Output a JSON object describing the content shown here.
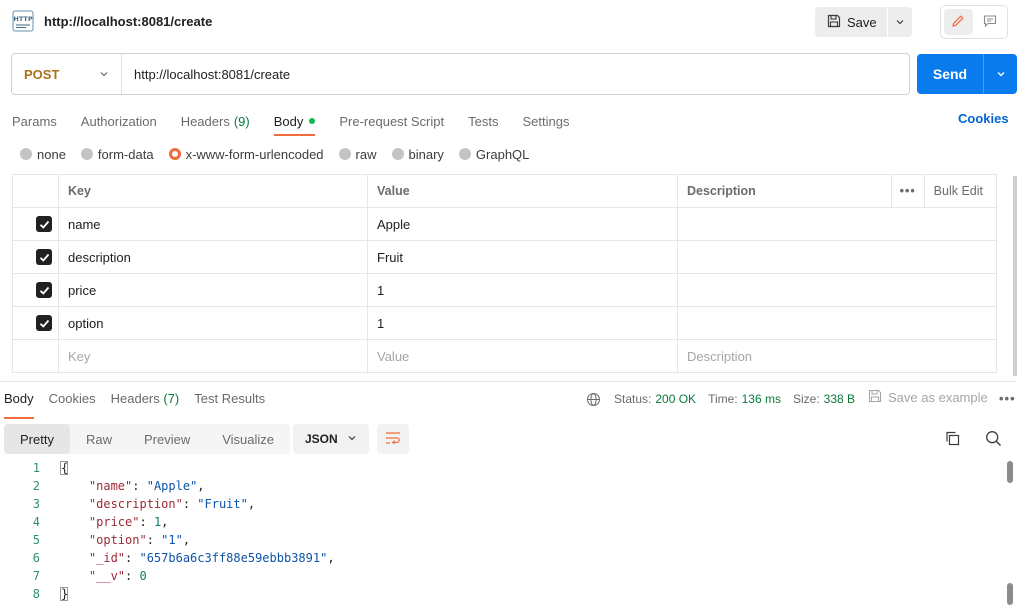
{
  "tab": {
    "title": "http://localhost:8081/create",
    "icon": "http-request-icon"
  },
  "toolbar": {
    "save_label": "Save"
  },
  "request": {
    "method": "POST",
    "url": "http://localhost:8081/create",
    "send_label": "Send"
  },
  "request_tabs": [
    {
      "label": "Params"
    },
    {
      "label": "Authorization"
    },
    {
      "label": "Headers",
      "count": "(9)"
    },
    {
      "label": "Body",
      "active": true
    },
    {
      "label": "Pre-request Script"
    },
    {
      "label": "Tests"
    },
    {
      "label": "Settings"
    }
  ],
  "cookies_link": "Cookies",
  "body_types": [
    {
      "label": "none"
    },
    {
      "label": "form-data"
    },
    {
      "label": "x-www-form-urlencoded",
      "selected": true
    },
    {
      "label": "raw"
    },
    {
      "label": "binary"
    },
    {
      "label": "GraphQL"
    }
  ],
  "params_table": {
    "headers": {
      "key": "Key",
      "value": "Value",
      "description": "Description",
      "bulk_edit": "Bulk Edit",
      "more": "•••"
    },
    "rows": [
      {
        "key": "name",
        "value": "Apple",
        "checked": true
      },
      {
        "key": "description",
        "value": "Fruit",
        "checked": true
      },
      {
        "key": "price",
        "value": "1",
        "checked": true
      },
      {
        "key": "option",
        "value": "1",
        "checked": true
      }
    ],
    "placeholders": {
      "key": "Key",
      "value": "Value",
      "description": "Description"
    }
  },
  "response": {
    "tabs": [
      {
        "label": "Body",
        "active": true
      },
      {
        "label": "Cookies"
      },
      {
        "label": "Headers",
        "count": "(7)"
      },
      {
        "label": "Test Results"
      }
    ],
    "status_label": "Status:",
    "status_value": "200 OK",
    "time_label": "Time:",
    "time_value": "136 ms",
    "size_label": "Size:",
    "size_value": "338 B",
    "save_example": "Save as example",
    "more": "•••",
    "view_tabs": [
      "Pretty",
      "Raw",
      "Preview",
      "Visualize"
    ],
    "format": "JSON"
  },
  "code_lines": [
    {
      "n": "1"
    },
    {
      "n": "2",
      "key": "\"name\"",
      "val": "\"Apple\"",
      "t": "s",
      "comma": ","
    },
    {
      "n": "3",
      "key": "\"description\"",
      "val": "\"Fruit\"",
      "t": "s",
      "comma": ","
    },
    {
      "n": "4",
      "key": "\"price\"",
      "val": "1",
      "t": "n",
      "comma": ","
    },
    {
      "n": "5",
      "key": "\"option\"",
      "val": "\"1\"",
      "t": "s",
      "comma": ","
    },
    {
      "n": "6",
      "key": "\"_id\"",
      "val": "\"657b6a6c3ff88e59ebbb3891\"",
      "t": "s",
      "comma": ","
    },
    {
      "n": "7",
      "key": "\"__v\"",
      "val": "0",
      "t": "n",
      "comma": ""
    },
    {
      "n": "8"
    }
  ],
  "colors": {
    "accent": "#f26b3a",
    "send": "#097bed",
    "method": "#a6731b",
    "status_ok": "#0a7a3b",
    "link": "#0265d2"
  }
}
